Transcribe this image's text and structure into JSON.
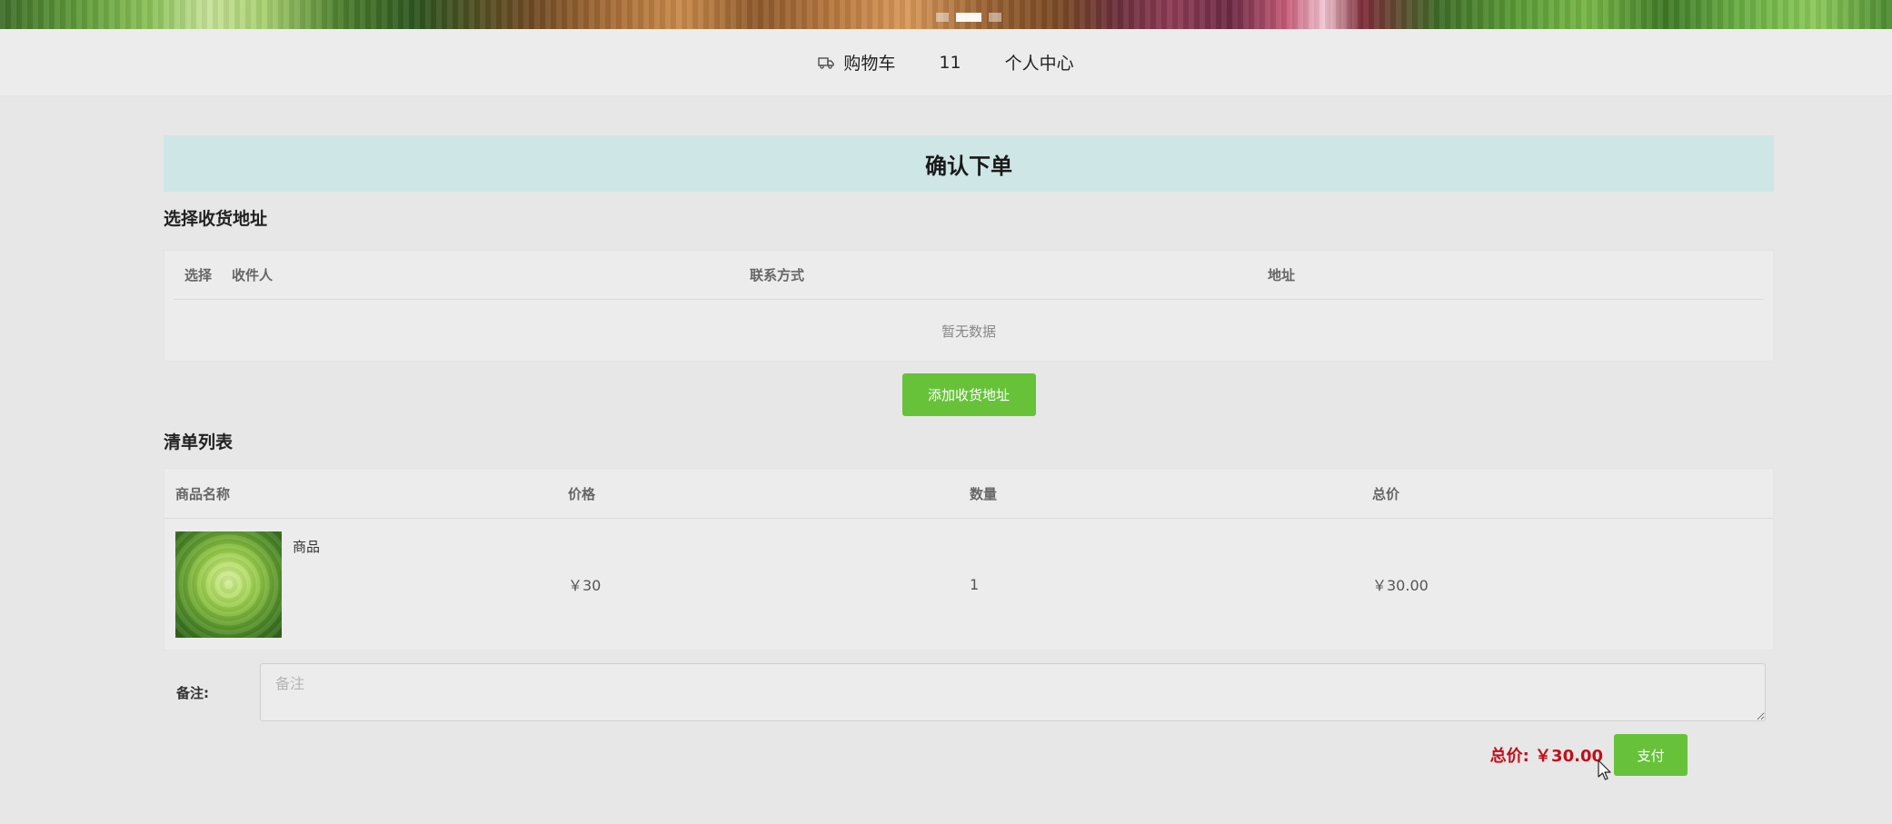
{
  "banner": {
    "slides": 3,
    "active_slide": 2
  },
  "nav": {
    "cart_label": "购物车",
    "cart_count": "11",
    "profile_label": "个人中心"
  },
  "page": {
    "title": "确认下单"
  },
  "address": {
    "section_title": "选择收货地址",
    "columns": [
      "选择",
      "收件人",
      "联系方式",
      "地址"
    ],
    "empty_text": "暂无数据",
    "add_button": "添加收货地址"
  },
  "order_list": {
    "section_title": "清单列表",
    "columns": [
      "商品名称",
      "价格",
      "数量",
      "总价"
    ],
    "rows": [
      {
        "name": "商品",
        "price": "￥30",
        "qty": "1",
        "total": "￥30.00",
        "image": "cabbage-image"
      }
    ]
  },
  "remark": {
    "label": "备注:",
    "placeholder": "备注",
    "value": ""
  },
  "summary": {
    "total_label": "总价: ￥30.00",
    "pay_button": "支付"
  },
  "colors": {
    "accent_green": "#67c23a",
    "title_bar_bg": "#cfe6e6",
    "total_red": "#c0101a",
    "page_bg": "#e7e7e7"
  }
}
